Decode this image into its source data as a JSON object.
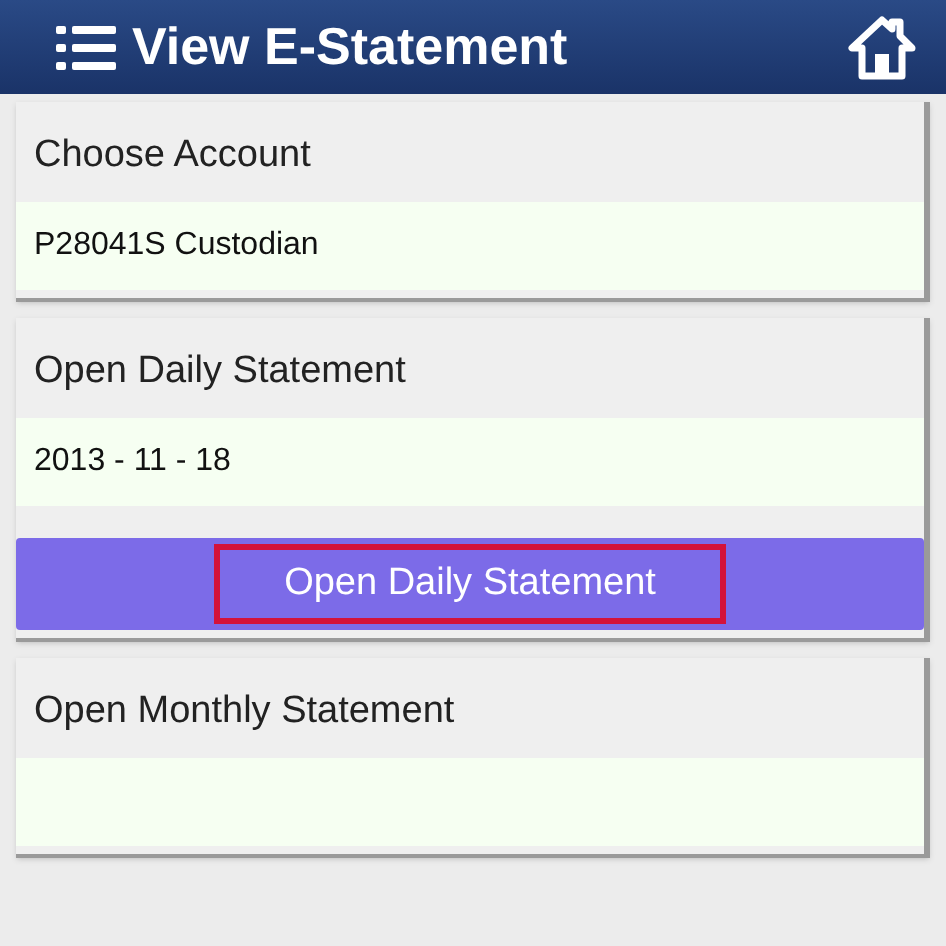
{
  "header": {
    "title": "View E-Statement"
  },
  "sections": [
    {
      "label": "Choose Account",
      "value": "P28041S Custodian"
    },
    {
      "label": "Open Daily Statement",
      "value": "2013 - 11 - 18",
      "button": {
        "label": "Open Daily Statement",
        "highlighted": true
      }
    },
    {
      "label": "Open Monthly Statement"
    }
  ]
}
